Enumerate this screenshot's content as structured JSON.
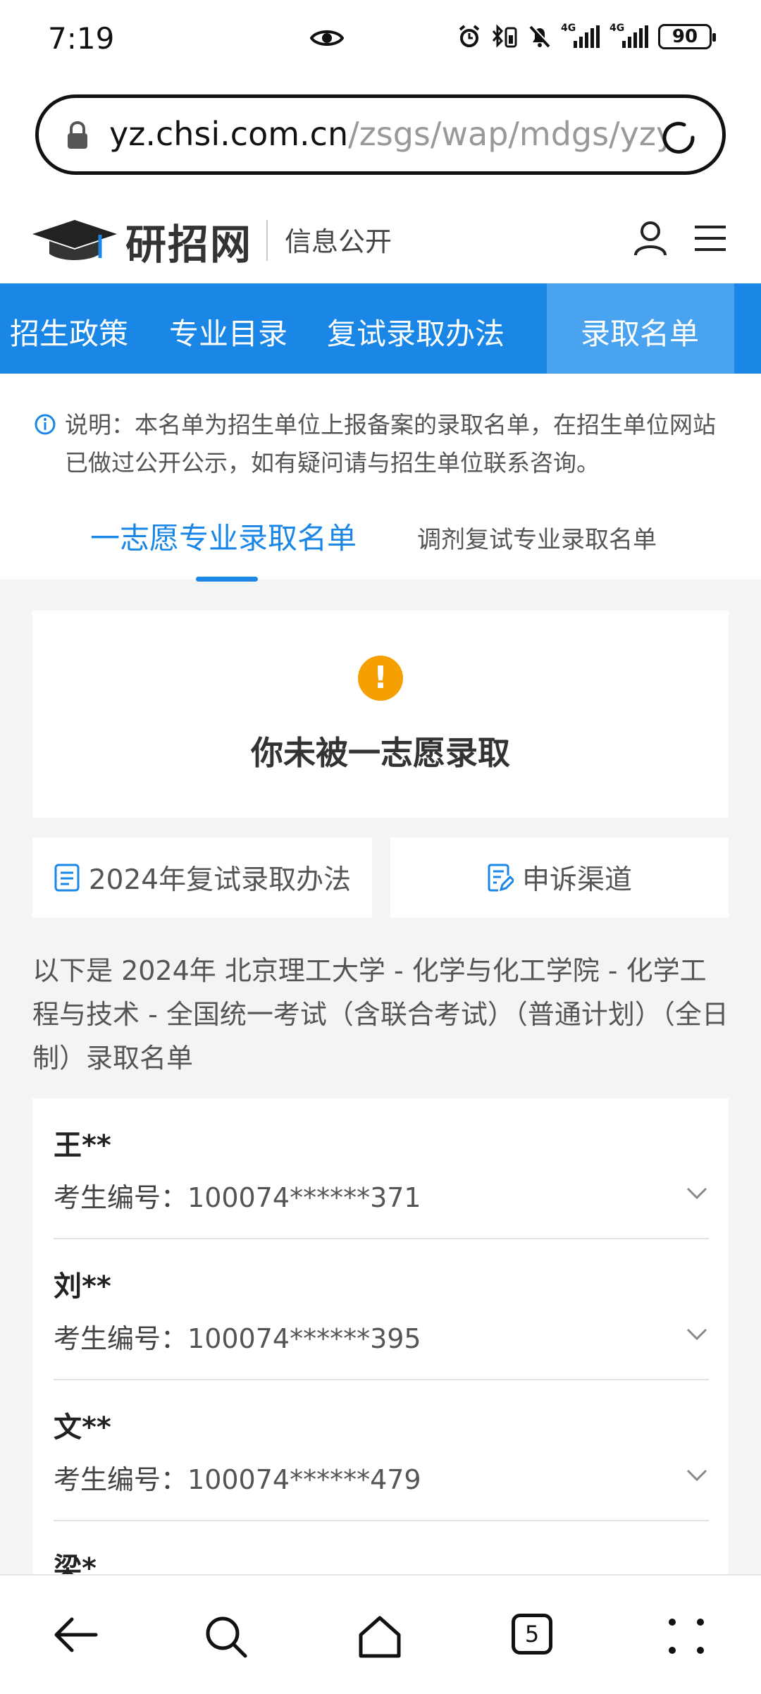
{
  "status": {
    "time": "7:19",
    "battery": "90",
    "network1": "4G",
    "network2": "4G"
  },
  "browser": {
    "url_host": "yz.chsi.com.cn",
    "url_path": "/zsgs/wap/mdgs/yzy",
    "tab_count": "5"
  },
  "site": {
    "logo_text": "研招网",
    "logo_sub": "信息公开"
  },
  "nav": {
    "items": [
      "招生政策",
      "专业目录",
      "复试录取办法",
      "录取名单"
    ],
    "active": "录取名单"
  },
  "notice": "说明：本名单为招生单位上报备案的录取名单，在招生单位网站已做过公开公示，如有疑问请与招生单位联系咨询。",
  "tabs": {
    "first": "一志愿专业录取名单",
    "second": "调剂复试专业录取名单"
  },
  "result": {
    "text": "你未被一志愿录取",
    "icon": "exclamation-icon",
    "color": "#f5a000"
  },
  "buttons": {
    "method": "2024年复试录取办法",
    "appeal": "申诉渠道"
  },
  "description": "以下是 2024年 北京理工大学 - 化学与化工学院 - 化学工程与技术 - 全国统一考试（含联合考试）（普通计划）（全日制）录取名单",
  "list": {
    "id_label": "考生编号：",
    "rows": [
      {
        "name": "王**",
        "id": "100074******371"
      },
      {
        "name": "刘**",
        "id": "100074******395"
      },
      {
        "name": "文**",
        "id": "100074******479"
      },
      {
        "name": "梁*",
        "id": ""
      }
    ]
  },
  "colors": {
    "accent": "#1a87e6",
    "nav_active": "#4aa3ee",
    "background": "#f3f4f6"
  }
}
